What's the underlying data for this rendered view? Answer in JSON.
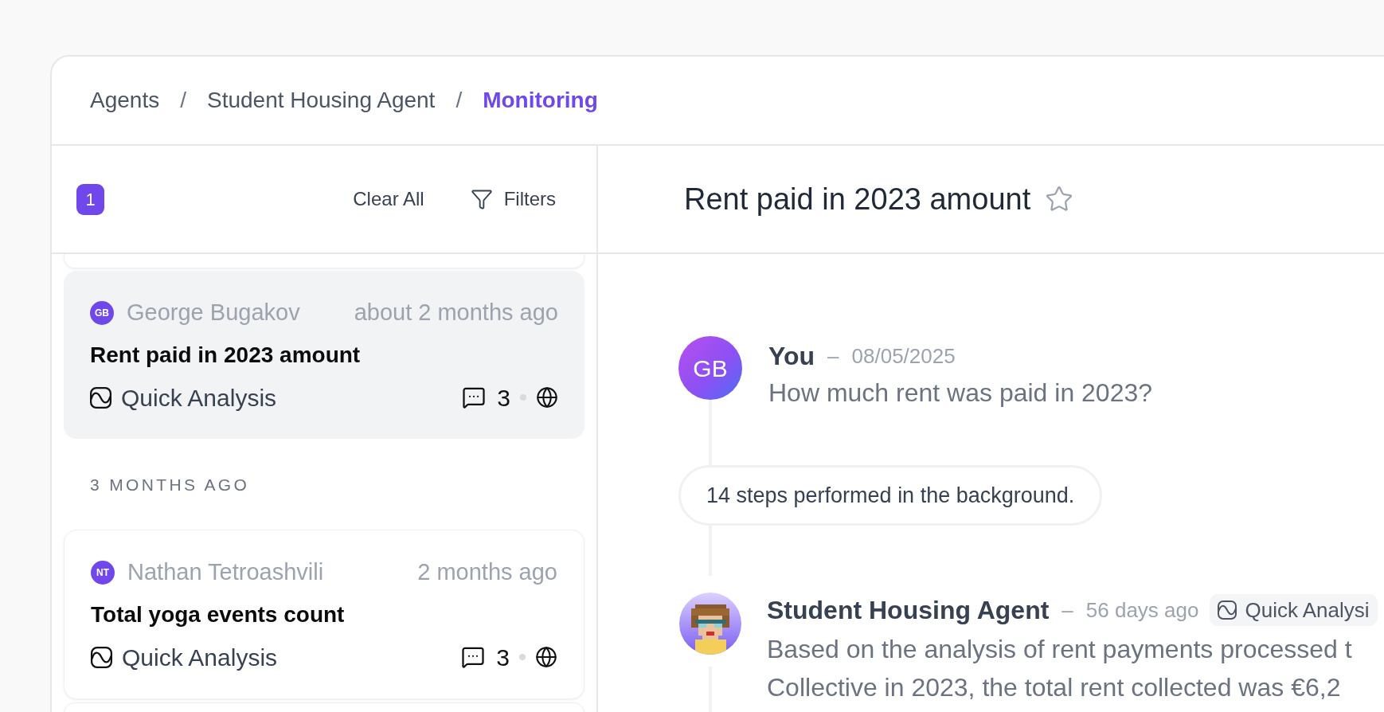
{
  "breadcrumb": [
    {
      "kind": "crumb",
      "label": "Agents",
      "selected": false
    },
    {
      "kind": "separator",
      "label": "/"
    },
    {
      "kind": "crumb",
      "label": "Student Housing Agent",
      "selected": false
    },
    {
      "kind": "separator",
      "label": "/"
    },
    {
      "kind": "crumb",
      "label": "Monitoring",
      "selected": true
    }
  ],
  "list_panel": {
    "filter_count": "1",
    "clear_button": "Clear All",
    "filters_button": "Filters",
    "items": [
      {
        "kind": "conversation",
        "initials": "GB",
        "author": "George Bugakov",
        "time": "about 2 months ago",
        "title": "Rent paid in 2023 amount",
        "tag": "Quick Analysis",
        "comments": "3",
        "selected": true
      },
      {
        "kind": "section",
        "label": "3 MONTHS AGO"
      },
      {
        "kind": "conversation",
        "initials": "NT",
        "author": "Nathan Tetroashvili",
        "time": "2 months ago",
        "title": "Total yoga events count",
        "tag": "Quick Analysis",
        "comments": "3",
        "selected": false
      }
    ]
  },
  "detail": {
    "title": "Rent paid in 2023 amount",
    "starred": false,
    "timeline": [
      {
        "kind": "message",
        "avatar": {
          "kind": "initials",
          "text": "GB"
        },
        "author": "You",
        "dash": "–",
        "time": "08/05/2025",
        "text": "How much rent was paid in 2023?"
      },
      {
        "kind": "steps",
        "text": "14 steps performed in the background."
      },
      {
        "kind": "message",
        "avatar": {
          "kind": "pixel"
        },
        "author": "Student Housing Agent",
        "dash": "–",
        "time": "56 days ago",
        "tag": "Quick Analysi",
        "text": "Based on the analysis of rent payments processed t\nCollective in 2023, the total rent collected was €6,2"
      }
    ]
  }
}
